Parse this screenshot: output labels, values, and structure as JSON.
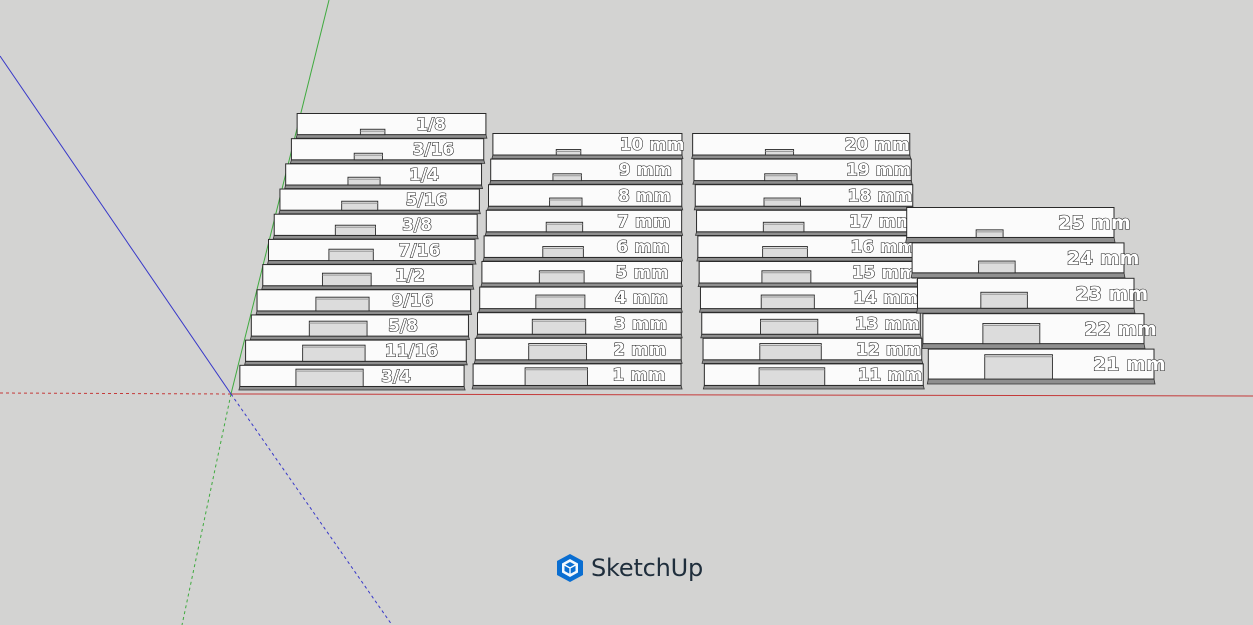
{
  "app": {
    "brand_name": "SketchUp",
    "brand_color": "#0a6ed1",
    "background_color": "#d3d3d2"
  },
  "axes": {
    "red_axis_color": "#c43a3a",
    "green_axis_color": "#3faa3f",
    "blue_axis_color": "#3838c8"
  },
  "model": {
    "groups": [
      {
        "id": "imperial",
        "labels": [
          "1/8",
          "3/16",
          "1/4",
          "5/16",
          "3/8",
          "7/16",
          "1/2",
          "9/16",
          "5/8",
          "11/16",
          "3/4"
        ]
      },
      {
        "id": "metric-1-10",
        "labels": [
          "10 mm",
          "9 mm",
          "8 mm",
          "7 mm",
          "6 mm",
          "5 mm",
          "4 mm",
          "3 mm",
          "2 mm",
          "1 mm"
        ]
      },
      {
        "id": "metric-11-20",
        "labels": [
          "20 mm",
          "19 mm",
          "18 mm",
          "17 mm",
          "16 mm",
          "15 mm",
          "14 mm",
          "13 mm",
          "12 mm",
          "11 mm"
        ]
      },
      {
        "id": "metric-21-25",
        "labels": [
          "25 mm",
          "24 mm",
          "23 mm",
          "22 mm",
          "21 mm"
        ]
      }
    ]
  }
}
